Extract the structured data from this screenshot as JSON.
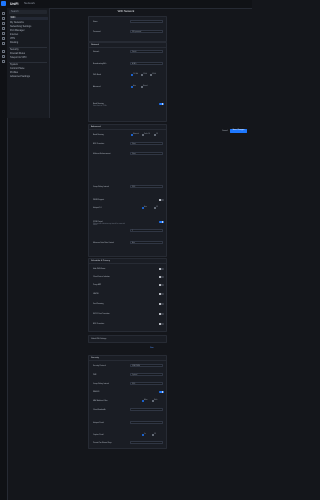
{
  "app": {
    "brand": "UniFi",
    "brand_sub": "Network",
    "page_title": "WiFi Network"
  },
  "sidebar": {
    "search_placeholder": "Search",
    "items": [
      {
        "label": "WiFi"
      },
      {
        "label": "My Networks"
      },
      {
        "label": "Networking Settings"
      },
      {
        "label": "Port Manager"
      },
      {
        "label": "Internet"
      },
      {
        "label": "VPN"
      },
      {
        "label": "Routing"
      },
      {
        "label": "Security"
      },
      {
        "label": "Firewall Rules"
      },
      {
        "label": "Teleport & VPN"
      },
      {
        "label": "System"
      },
      {
        "label": "Control Plane"
      },
      {
        "label": "Profiles"
      },
      {
        "label": "Advanced Settings"
      }
    ]
  },
  "general": {
    "name_label": "Name",
    "password_label": "Password",
    "password_hint": "WiFi password"
  },
  "network": {
    "header": "Network",
    "items": [
      {
        "label": "Network",
        "value": "Default"
      },
      {
        "label": "Broadcasting APs",
        "value": "All APs"
      },
      {
        "label": "WiFi Band",
        "opts": [
          "2.4 GHz",
          "5 GHz",
          "6 GHz"
        ]
      },
      {
        "label": "Advanced",
        "opts": [
          "Auto",
          "Manual"
        ]
      },
      {
        "label": "Band Steering",
        "sub": "Steer clients to 5 GHz"
      }
    ]
  },
  "advanced": {
    "header": "Advanced",
    "items": [
      {
        "label": "Band Steering",
        "opts": [
          "Balanced",
          "Prefer 5G",
          "Off"
        ]
      },
      {
        "label": "BSS Transition",
        "value": "Select"
      },
      {
        "label": "Multicast Enhancement",
        "value": "Select"
      },
      {
        "label": "Group Rekey Interval",
        "value": "3600"
      },
      {
        "label": "WPA3 Support"
      },
      {
        "label": "Hotspot 2.0",
        "opts": [
          "Auto",
          "Off"
        ]
      },
      {
        "label": "DTIM Period",
        "sub": "Delivery traffic indication map interval for connected clients",
        "value": "3"
      },
      {
        "label": "Minimum Data Rate Control",
        "value": "Auto"
      }
    ]
  },
  "schedule": {
    "header": "Schedule & Privacy",
    "items": [
      {
        "label": "Hide WiFi Name"
      },
      {
        "label": "Client Device Isolation"
      },
      {
        "label": "Proxy ARP"
      },
      {
        "label": "UAPSD"
      },
      {
        "label": "Fast Roaming"
      },
      {
        "label": "802.11 Fast Transition"
      },
      {
        "label": "BSS Transition"
      }
    ]
  },
  "collapsed": {
    "label": "Global WiFi Settings",
    "link": "Show"
  },
  "security": {
    "header": "Security",
    "items": [
      {
        "label": "Security Protocol",
        "value": "WPA2/WPA3"
      },
      {
        "label": "PMF",
        "value": "Optional"
      },
      {
        "label": "Group Rekey Interval",
        "value": "3600"
      },
      {
        "label": "RADIUS",
        "value": ""
      },
      {
        "label": "MAC Address Filter",
        "opts": [
          "Allow",
          "Block"
        ]
      },
      {
        "label": "Client Bandwidth",
        "value": ""
      },
      {
        "label": "Hotspot Portal",
        "value": ""
      },
      {
        "label": "Captive Portal",
        "opts": [
          "On",
          "Off"
        ]
      },
      {
        "label": "Private Pre-Shared Keys",
        "value": ""
      }
    ]
  },
  "actions": {
    "cancel": "Cancel",
    "save": "Save Changes"
  },
  "colors": {
    "accent": "#1e78ff",
    "background": "#14161b",
    "panel": "#1a1d24"
  }
}
